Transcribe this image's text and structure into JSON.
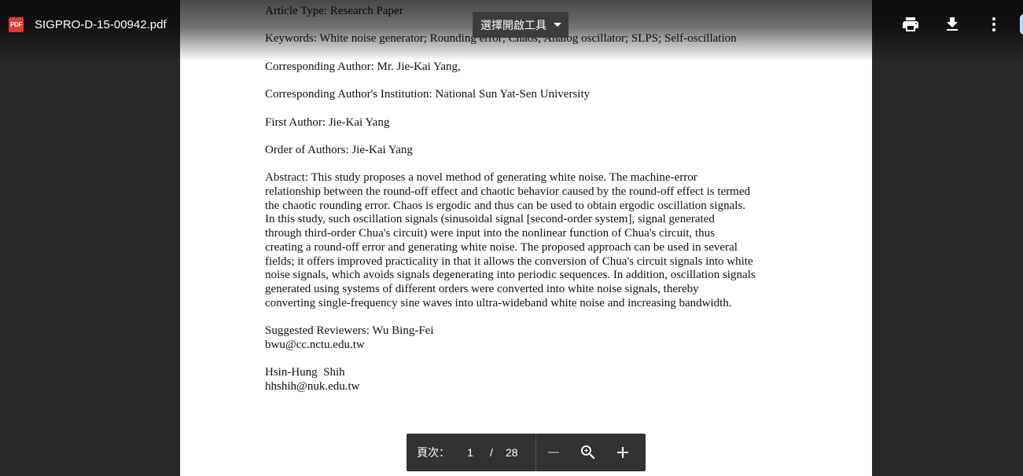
{
  "toolbar": {
    "filename": "SIGPRO-D-15-00942.pdf",
    "pdf_icon_text": "PDF",
    "open_with_label": "選擇開啟工具",
    "icons": [
      "print-icon",
      "download-icon",
      "more-vert-icon"
    ]
  },
  "document": {
    "article_type": "Article Type: Research Paper",
    "keywords": "Keywords: White noise generator; Rounding error; Chaos; Analog oscillator; SLPS; Self-oscillation",
    "corresponding_author": "Corresponding Author: Mr. Jie-Kai Yang,",
    "institution": "Corresponding Author's Institution: National Sun Yat-Sen University",
    "first_author": "First Author: Jie-Kai Yang",
    "order_of_authors": "Order of Authors: Jie-Kai Yang",
    "abstract_lines": [
      "Abstract: This study proposes a novel method of generating white noise. The machine-error",
      "relationship between the round-off effect and chaotic behavior caused by the round-off effect is termed",
      "the chaotic rounding error. Chaos is ergodic and thus can be used to obtain ergodic oscillation signals.",
      "In this study, such oscillation signals (sinusoidal signal [second-order system], signal generated",
      "through third-order Chua's circuit) were input into the nonlinear function of Chua's circuit, thus",
      "creating a round-off error and generating white noise. The proposed approach can be used in several",
      "fields; it offers improved practicality in that it allows the conversion of Chua's circuit signals into white",
      "noise signals, which avoids signals degenerating into periodic sequences. In addition, oscillation signals",
      "generated using systems of different orders were converted into white noise signals, thereby",
      "converting single-frequency sine waves into ultra-wideband white noise and increasing bandwidth."
    ],
    "reviewers": [
      "Suggested Reviewers: Wu Bing-Fei",
      "bwu@cc.nctu.edu.tw",
      "",
      "Hsin-Hung  Shih",
      "hhshih@nuk.edu.tw"
    ]
  },
  "pagination": {
    "label": "頁次：",
    "current": "1",
    "separator": "/",
    "total": "28",
    "icons": [
      "zoom-out-icon",
      "fit-zoom-icon",
      "zoom-in-icon"
    ]
  }
}
